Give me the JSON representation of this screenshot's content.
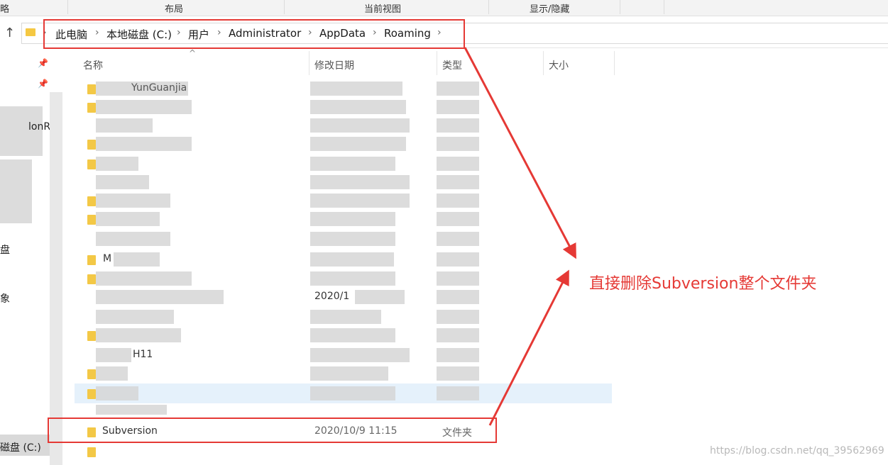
{
  "ribbon": {
    "groups": [
      "略",
      "布局",
      "当前视图",
      "显示/隐藏"
    ]
  },
  "address_bar": {
    "crumbs": [
      "此电脑",
      "本地磁盘 (C:)",
      "用户",
      "Administrator",
      "AppData",
      "Roaming"
    ]
  },
  "nav_pane": {
    "partial_labels": [
      "lonR",
      "盘",
      "象",
      "磁盘 (C:)"
    ]
  },
  "columns": {
    "name": "名称",
    "modified": "修改日期",
    "type": "类型",
    "size": "大小"
  },
  "rows_partial": {
    "row0_name": "YunGuanjia",
    "row9_name": "M",
    "row11_date": "2020/1",
    "row16_name": "H11"
  },
  "target_row": {
    "name": "Subversion",
    "date": "2020/10/9 11:15",
    "type": "文件夹"
  },
  "annotation": {
    "text": "直接删除Subversion整个文件夹",
    "color": "#e53935"
  },
  "watermark": "https://blog.csdn.net/qq_39562969",
  "colors": {
    "folder": "#f3c846",
    "selection": "#e5f1fb"
  }
}
